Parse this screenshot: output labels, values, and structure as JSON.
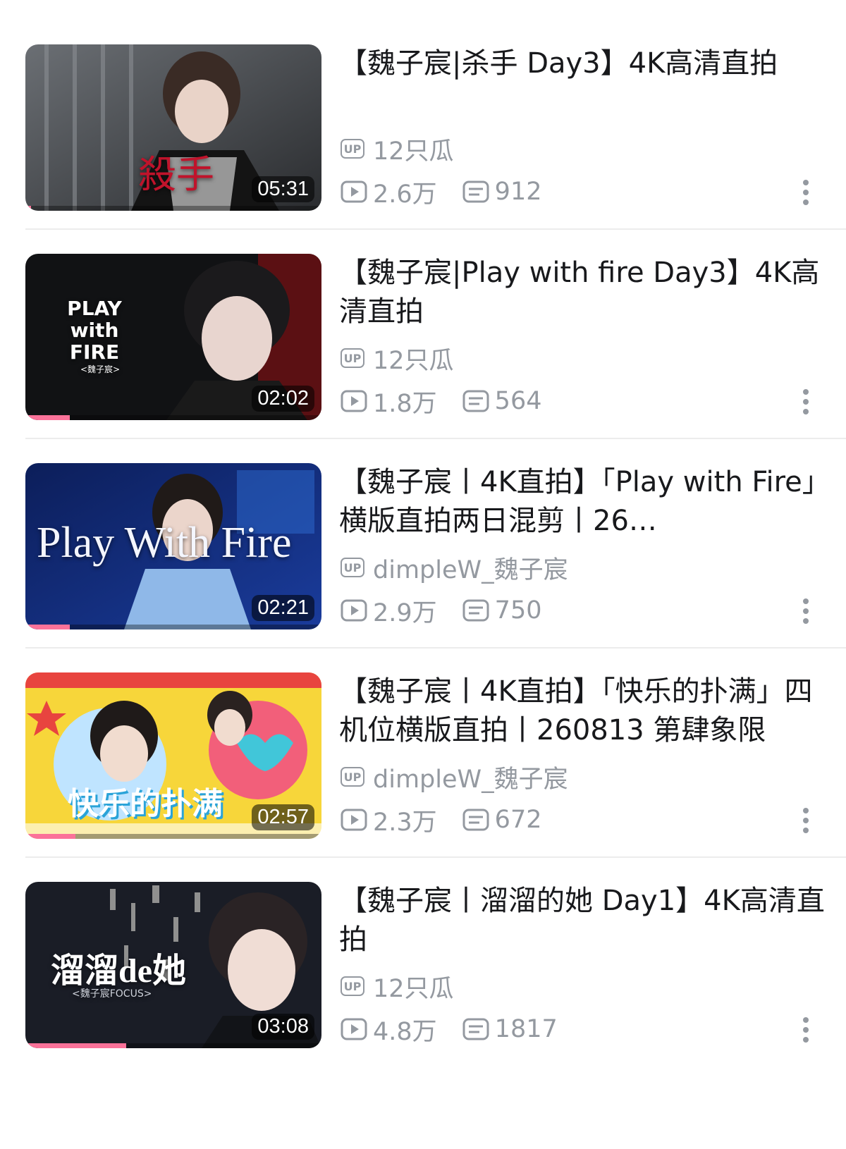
{
  "accent_color": "#fb7299",
  "meta_color": "#9499a0",
  "videos": [
    {
      "title": "【魏子宸|杀手 Day3】4K高清直拍",
      "thumb_text": "殺手",
      "duration": "05:31",
      "progress": 0.02,
      "uploader": "12只瓜",
      "views": "2.6万",
      "danmaku": "912"
    },
    {
      "title": "【魏子宸|Play with fire Day3】4K高清直拍",
      "thumb_text": "PLAY with FIRE",
      "thumb_sub": "<魏子宸>",
      "duration": "02:02",
      "progress": 0.15,
      "uploader": "12只瓜",
      "views": "1.8万",
      "danmaku": "564"
    },
    {
      "title": "【魏子宸丨4K直拍】「Play with Fire」横版直拍两日混剪丨26…",
      "thumb_text": "Play With Fire",
      "duration": "02:21",
      "progress": 0.15,
      "uploader": "dimpleW_魏子宸",
      "views": "2.9万",
      "danmaku": "750"
    },
    {
      "title": "【魏子宸丨4K直拍】「快乐的扑满」四机位横版直拍丨260813 第肆象限",
      "thumb_text": "快乐的扑满",
      "duration": "02:57",
      "progress": 0.17,
      "uploader": "dimpleW_魏子宸",
      "views": "2.3万",
      "danmaku": "672"
    },
    {
      "title": "【魏子宸丨溜溜的她 Day1】4K高清直拍",
      "thumb_text": "溜溜de她",
      "thumb_sub": "<魏子宸FOCUS>",
      "duration": "03:08",
      "progress": 0.34,
      "uploader": "12只瓜",
      "views": "4.8万",
      "danmaku": "1817"
    }
  ]
}
